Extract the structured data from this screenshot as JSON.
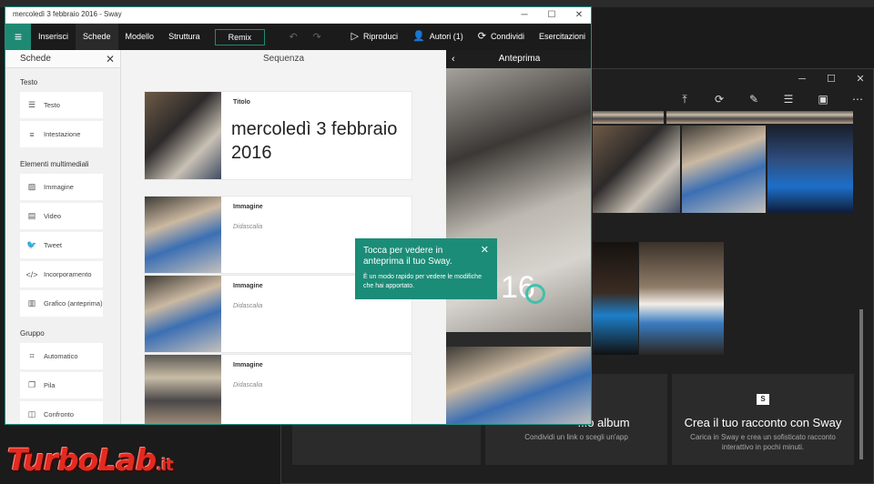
{
  "sway": {
    "title": "mercoledì 3 febbraio 2016 - Sway",
    "ribbon_tabs": [
      "Inserisci",
      "Schede",
      "Modello",
      "Struttura"
    ],
    "active_tab": "Schede",
    "remix": "Remix",
    "actions": {
      "play": "Riproduci",
      "authors": "Autori (1)",
      "share": "Condividi",
      "tutorials": "Esercitazioni"
    },
    "cards_panel": {
      "heading": "Schede",
      "groups": [
        {
          "name": "Testo",
          "items": [
            {
              "label": "Testo",
              "icon": "text-lines-icon"
            },
            {
              "label": "Intestazione",
              "icon": "heading-icon"
            }
          ]
        },
        {
          "name": "Elementi multimediali",
          "items": [
            {
              "label": "Immagine",
              "icon": "image-icon"
            },
            {
              "label": "Video",
              "icon": "video-icon"
            },
            {
              "label": "Tweet",
              "icon": "twitter-bird-icon"
            },
            {
              "label": "Incorporamento",
              "icon": "code-brackets-icon"
            },
            {
              "label": "Grafico (anteprima)",
              "icon": "chart-icon"
            }
          ]
        },
        {
          "name": "Gruppo",
          "items": [
            {
              "label": "Automatico",
              "icon": "auto-group-icon"
            },
            {
              "label": "Pila",
              "icon": "stack-icon"
            },
            {
              "label": "Confronto",
              "icon": "compare-icon"
            }
          ]
        }
      ]
    },
    "storyline": {
      "heading": "Sequenza",
      "title_card": {
        "label": "Titolo",
        "text": "mercoledì 3 febbraio 2016"
      },
      "image_cards": [
        {
          "label": "Immagine",
          "caption": "Didascalia"
        },
        {
          "label": "Immagine",
          "caption": "Didascalia"
        },
        {
          "label": "Immagine",
          "caption": "Didascalia"
        }
      ]
    },
    "preview": {
      "heading": "Anteprima",
      "year_fragment": "16"
    },
    "tooltip": {
      "title": "Tocca per vedere in anteprima il tuo Sway.",
      "body": "È un modo rapido per vedere le modifiche che hai apportato."
    }
  },
  "photos_app": {
    "tiles": [
      {
        "title": "...o album",
        "subtitle": "Condividi un link o scegli un'app"
      },
      {
        "title": "Crea il tuo racconto con Sway",
        "subtitle": "Carica in Sway e crea un sofisticato racconto interattivo in pochi minuti.",
        "icon": "sway-logo-icon"
      }
    ]
  },
  "watermark": {
    "brand": "TurboLab",
    "tld": ".it"
  },
  "colors": {
    "accent": "#1e8a74",
    "ribbon": "#1b1b1b",
    "watermark": "#e32a20"
  }
}
